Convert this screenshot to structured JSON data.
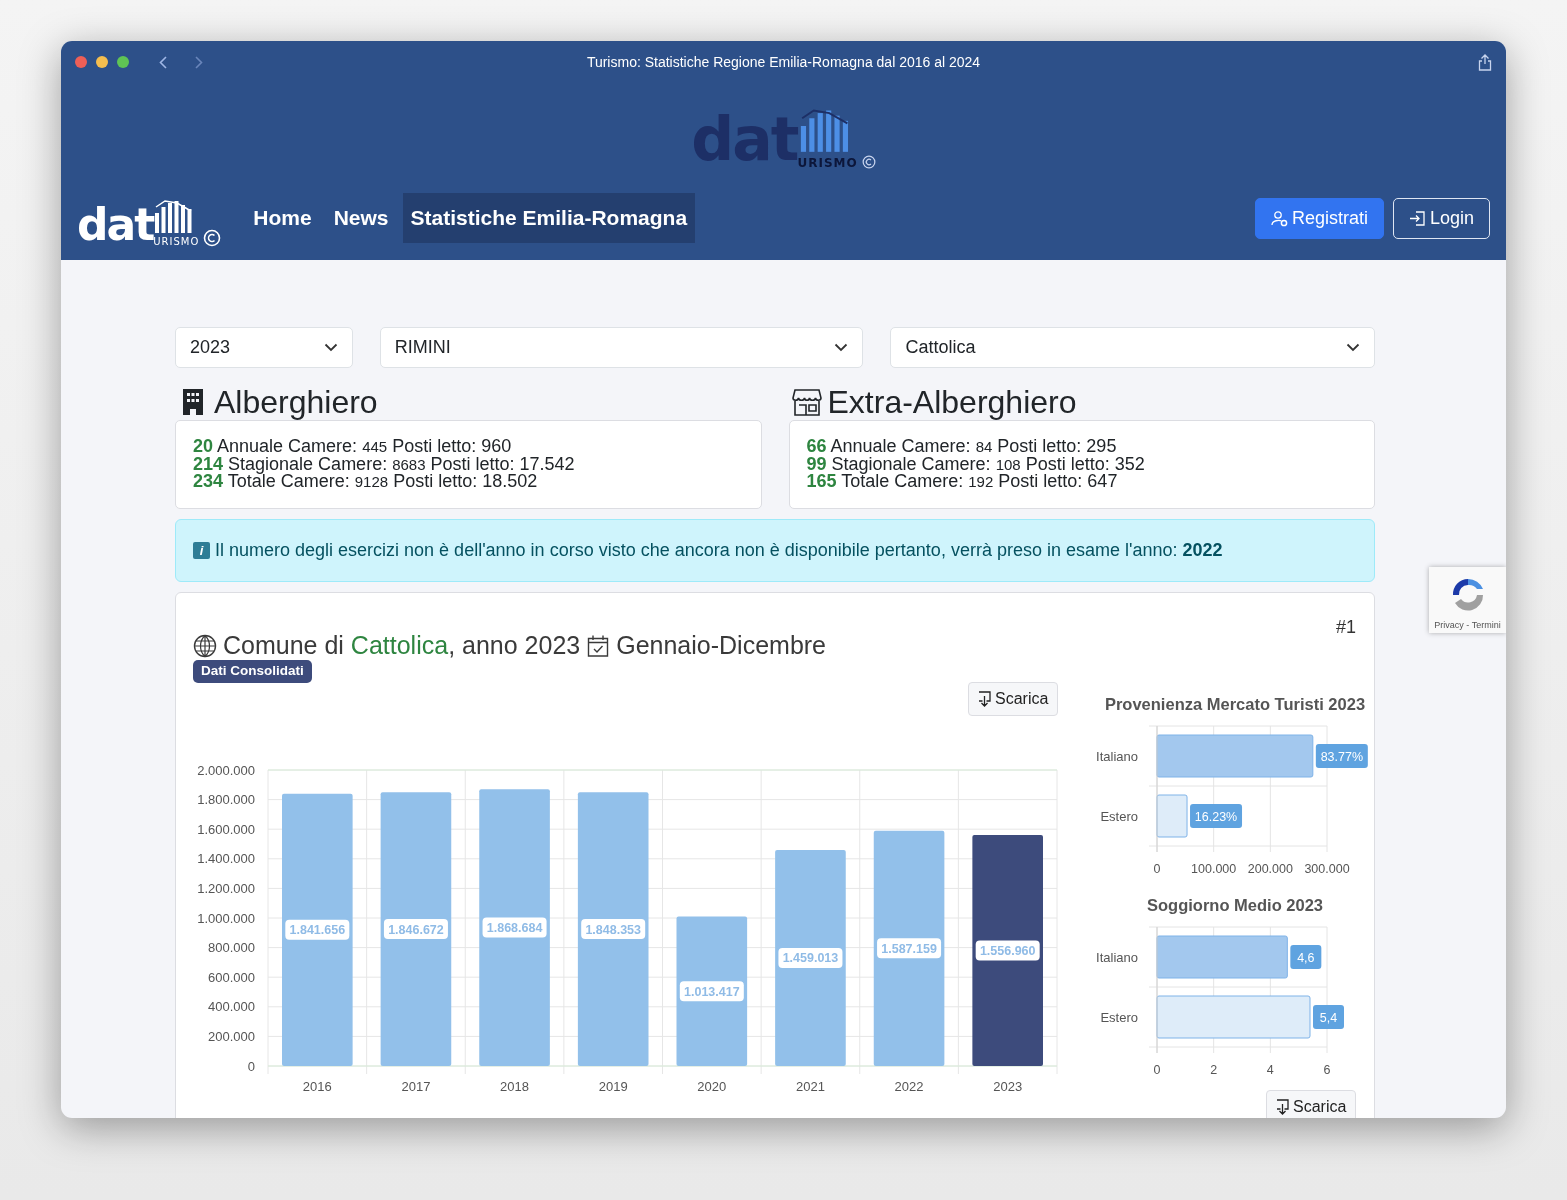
{
  "window": {
    "title": "Turismo: Statistiche Regione Emilia-Romagna dal 2016 al 2024"
  },
  "banner_logo": {
    "word": "dat",
    "subword": "URISMO"
  },
  "nav": {
    "logo": {
      "word": "dat",
      "subword": "URISMO"
    },
    "items": [
      {
        "label": "Home",
        "selected": false
      },
      {
        "label": "News",
        "selected": false
      },
      {
        "label": "Statistiche Emilia-Romagna",
        "selected": true
      }
    ],
    "buttons": [
      {
        "label": "Registrati",
        "kind": "primary"
      },
      {
        "label": "Login",
        "kind": "outline"
      }
    ]
  },
  "filters": [
    {
      "value": "2023"
    },
    {
      "value": "RIMINI"
    },
    {
      "value": "Cattolica"
    }
  ],
  "sections": [
    {
      "title": "Alberghiero",
      "kind": "hotel",
      "rows": [
        {
          "count": "20",
          "type": "Annuale",
          "rooms_label": "Camere:",
          "rooms": "445",
          "beds_label": "Posti letto:",
          "beds": "960"
        },
        {
          "count": "214",
          "type": "Stagionale",
          "rooms_label": "Camere:",
          "rooms": "8683",
          "beds_label": "Posti letto:",
          "beds": "17.542"
        },
        {
          "count": "234",
          "type": "Totale",
          "rooms_label": "Camere:",
          "rooms": "9128",
          "beds_label": "Posti letto:",
          "beds": "18.502"
        }
      ]
    },
    {
      "title": "Extra-Alberghiero",
      "kind": "shop",
      "rows": [
        {
          "count": "66",
          "type": "Annuale",
          "rooms_label": "Camere:",
          "rooms": "84",
          "beds_label": "Posti letto:",
          "beds": "295"
        },
        {
          "count": "99",
          "type": "Stagionale",
          "rooms_label": "Camere:",
          "rooms": "108",
          "beds_label": "Posti letto:",
          "beds": "352"
        },
        {
          "count": "165",
          "type": "Totale",
          "rooms_label": "Camere:",
          "rooms": "192",
          "beds_label": "Posti letto:",
          "beds": "647"
        }
      ]
    }
  ],
  "alert": {
    "icon_glyph": "i",
    "text": "Il numero degli esercizi non è dell'anno in corso visto che ancora non è disponibile pertanto, verrà preso in esame l'anno: **2022**"
  },
  "card": {
    "number": "#1",
    "title_prefix": "Comune di ",
    "place": "Cattolica",
    "title_suffix": ", anno 2023",
    "period": "Gennaio-Dicembre",
    "badge": "Dati Consolidati",
    "download": "Scarica",
    "chart_data": {
      "type": "bar",
      "categories": [
        "2016",
        "2017",
        "2018",
        "2019",
        "2020",
        "2021",
        "2022",
        "2023"
      ],
      "series": [
        {
          "color": "#92c0ea",
          "values": [
            1840000,
            1850000,
            1870000,
            1850000,
            1010000,
            1460000,
            1590000,
            null
          ]
        },
        {
          "color": "#3d4b7c",
          "values": [
            null,
            null,
            null,
            null,
            null,
            null,
            null,
            1560000
          ]
        }
      ],
      "stacked": true,
      "grid": true,
      "ylim": [
        0,
        2000000
      ],
      "yticks": [
        {
          "value": 0,
          "label": "0"
        },
        {
          "value": 200000,
          "label": "200.000"
        },
        {
          "value": 400000,
          "label": "400.000"
        },
        {
          "value": 600000,
          "label": "600.000"
        },
        {
          "value": 800000,
          "label": "800.000"
        },
        {
          "value": 1000000,
          "label": "1.000.000"
        },
        {
          "value": 1200000,
          "label": "1.200.000"
        },
        {
          "value": 1400000,
          "label": "1.400.000"
        },
        {
          "value": 1600000,
          "label": "1.600.000"
        },
        {
          "value": 1800000,
          "label": "1.800.000"
        },
        {
          "value": 2000000,
          "label": "2.000.000"
        }
      ],
      "value_labels": [
        "1.841.656",
        "1.846.672",
        "1.868.684",
        "1.848.353",
        "1.013.417",
        "1.459.013",
        "1.587.159",
        "1.556.960"
      ]
    },
    "side_charts": [
      {
        "chart_data": {
          "type": "bar",
          "orientation": "horizontal",
          "title": "Provenienza Mercato Turisti 2023",
          "categories": [
            "Italiano",
            "Estero"
          ],
          "series": [
            {
              "color": "#a3c8ee",
              "values": [
                275000,
                null
              ]
            },
            {
              "color": "#deecf9",
              "values": [
                null,
                53000
              ]
            }
          ],
          "stacked": true,
          "xlim": [
            0,
            300000
          ],
          "xticks": [
            {
              "value": 0,
              "label": "0"
            },
            {
              "value": 100000,
              "label": "100.000"
            },
            {
              "value": 200000,
              "label": "200.000"
            },
            {
              "value": 300000,
              "label": "300.000"
            }
          ],
          "value_labels": [
            "83.77%",
            "16.23%"
          ]
        }
      },
      {
        "chart_data": {
          "type": "bar",
          "orientation": "horizontal",
          "title": "Soggiorno Medio 2023",
          "categories": [
            "Italiano",
            "Estero"
          ],
          "series": [
            {
              "color": "#a3c8ee",
              "values": [
                4.6,
                null
              ]
            },
            {
              "color": "#deecf9",
              "values": [
                null,
                5.4
              ]
            }
          ],
          "stacked": true,
          "xlim": [
            0,
            6
          ],
          "xticks": [
            0,
            2,
            4,
            6
          ],
          "value_labels": [
            "4,6",
            "5,4"
          ]
        }
      }
    ],
    "bottom_button": "Scarica"
  },
  "recaptcha": {
    "text": "Privacy - Termini"
  }
}
